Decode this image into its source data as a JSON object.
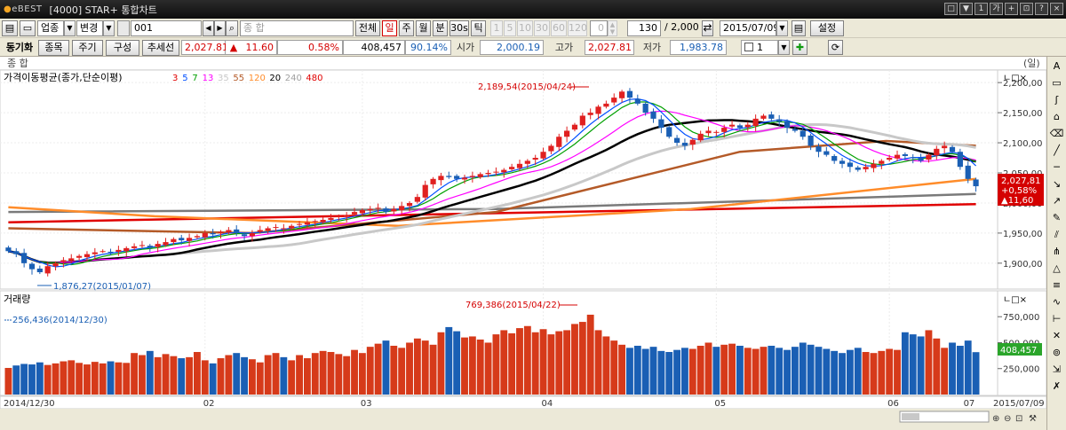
{
  "window": {
    "logo": "eBEST",
    "title": "[4000] STAR+ 통합차트",
    "controls": [
      "□",
      "▼",
      "1",
      "가",
      "+",
      "⊡",
      "?",
      "×"
    ]
  },
  "toolbar": {
    "market_type": "업종",
    "change_label": "변경",
    "code": "001",
    "search_placeholder": "종          합",
    "period_buttons": [
      {
        "label": "전체",
        "active": false
      },
      {
        "label": "일",
        "active": true
      },
      {
        "label": "주",
        "active": false
      },
      {
        "label": "월",
        "active": false
      },
      {
        "label": "분",
        "active": false
      },
      {
        "label": "30s",
        "active": false
      },
      {
        "label": "틱",
        "active": false
      }
    ],
    "interval_buttons": [
      "1",
      "5",
      "10",
      "30",
      "60",
      "120"
    ],
    "interval_value": "0",
    "count_value": "130",
    "total_count": "/ 2,000",
    "date_value": "2015/07/09",
    "settings_label": "설정"
  },
  "quote": {
    "sync_label": "동기화",
    "item_btn": "종목",
    "cycle_btn": "주기",
    "compose_btn": "구성",
    "trend_btn": "추세선",
    "price": "2,027.81",
    "change_arrow": "▲",
    "change": "11.60",
    "change_pct": "0.58%",
    "volume": "408,457",
    "volume_ratio": "90.14%",
    "open_label": "시가",
    "open": "2,000.19",
    "high_label": "고가",
    "high": "2,027.81",
    "low_label": "저가",
    "low": "1,983.78",
    "layout_value": "1"
  },
  "tabstrip": {
    "name": "종          합",
    "unit": "(일)"
  },
  "chart_data": [
    {
      "type": "candlestick",
      "title": "가격이동평균(종가,단순이평)",
      "legend": [
        {
          "name": "3",
          "color": "#e00000"
        },
        {
          "name": "5",
          "color": "#0050ff"
        },
        {
          "name": "7",
          "color": "#00a000"
        },
        {
          "name": "13",
          "color": "#ff00ff"
        },
        {
          "name": "35",
          "color": "#c8c8c8"
        },
        {
          "name": "55",
          "color": "#b45a28"
        },
        {
          "name": "120",
          "color": "#ff8c2a"
        },
        {
          "name": "20",
          "color": "#000000"
        },
        {
          "name": "240",
          "color": "#a0a0a0"
        },
        {
          "name": "480",
          "color": "#e00000"
        }
      ],
      "y_ticks": [
        "2,200,00",
        "2,150,00",
        "2,100,00",
        "2,050,00",
        "2,000,00",
        "1,950,00",
        "1,900,00"
      ],
      "ylim": [
        1860,
        2212
      ],
      "annotations": [
        "2,189,54(2015/04/24)",
        "1,876,27(2015/01/07)"
      ],
      "last_price_tag": [
        "2,027,81",
        "+0,58%",
        "▲11,60"
      ],
      "close_series": [
        1920,
        1915,
        1900,
        1890,
        1885,
        1895,
        1900,
        1905,
        1908,
        1912,
        1915,
        1918,
        1920,
        1918,
        1922,
        1925,
        1928,
        1930,
        1926,
        1932,
        1935,
        1940,
        1938,
        1942,
        1945,
        1950,
        1948,
        1952,
        1955,
        1950,
        1945,
        1950,
        1955,
        1958,
        1960,
        1958,
        1962,
        1965,
        1968,
        1970,
        1972,
        1975,
        1978,
        1980,
        1985,
        1988,
        1990,
        1992,
        1985,
        1990,
        1995,
        2000,
        2010,
        2030,
        2040,
        2045,
        2043,
        2040,
        2042,
        2045,
        2048,
        2050,
        2052,
        2055,
        2060,
        2065,
        2070,
        2075,
        2085,
        2095,
        2110,
        2120,
        2130,
        2145,
        2150,
        2160,
        2165,
        2175,
        2185,
        2175,
        2165,
        2150,
        2140,
        2125,
        2110,
        2100,
        2095,
        2105,
        2115,
        2120,
        2118,
        2125,
        2130,
        2125,
        2130,
        2140,
        2145,
        2140,
        2135,
        2125,
        2120,
        2110,
        2095,
        2085,
        2080,
        2070,
        2065,
        2060,
        2055,
        2060,
        2065,
        2070,
        2075,
        2080,
        2078,
        2075,
        2070,
        2080,
        2090,
        2095,
        2085,
        2060,
        2040,
        2027.81
      ],
      "moving_averages": [
        {
          "name": "20",
          "color": "#000000"
        },
        {
          "name": "35",
          "color": "#c8c8c8"
        },
        {
          "name": "55",
          "color": "#b45a28"
        },
        {
          "name": "120",
          "color": "#ff8c2a"
        },
        {
          "name": "240",
          "color": "#7a7a7a"
        },
        {
          "name": "480",
          "color": "#e00000"
        }
      ]
    },
    {
      "type": "bar",
      "title": "거래량",
      "y_ticks": [
        "750,000",
        "500,000",
        "250,000"
      ],
      "ylim": [
        0,
        880000
      ],
      "last_value_tag": "408,457",
      "annotations": [
        "769,386(2015/04/22)",
        "256,436(2014/12/30)"
      ],
      "x_labels": [
        "2014/12/30",
        "02",
        "03",
        "04",
        "05",
        "06",
        "07",
        "2015/07/09"
      ],
      "values": [
        256436,
        280000,
        295000,
        290000,
        310000,
        285000,
        300000,
        320000,
        330000,
        305000,
        290000,
        315000,
        300000,
        320000,
        310000,
        305000,
        400000,
        380000,
        420000,
        360000,
        390000,
        370000,
        350000,
        360000,
        410000,
        330000,
        300000,
        350000,
        380000,
        400000,
        360000,
        340000,
        310000,
        380000,
        400000,
        360000,
        330000,
        380000,
        350000,
        400000,
        420000,
        410000,
        390000,
        370000,
        430000,
        400000,
        460000,
        490000,
        520000,
        470000,
        450000,
        500000,
        540000,
        520000,
        480000,
        600000,
        650000,
        610000,
        550000,
        560000,
        530000,
        500000,
        580000,
        620000,
        590000,
        640000,
        660000,
        600000,
        630000,
        580000,
        610000,
        620000,
        680000,
        700000,
        769386,
        620000,
        560000,
        520000,
        480000,
        450000,
        470000,
        440000,
        460000,
        420000,
        410000,
        430000,
        450000,
        440000,
        470000,
        500000,
        460000,
        480000,
        490000,
        470000,
        450000,
        440000,
        460000,
        470000,
        450000,
        430000,
        460000,
        500000,
        480000,
        460000,
        440000,
        420000,
        400000,
        430000,
        450000,
        410000,
        400000,
        420000,
        440000,
        430000,
        600000,
        580000,
        560000,
        620000,
        540000,
        450000,
        500000,
        470000,
        520000,
        408457
      ]
    }
  ],
  "bottom": {
    "zoom": "25%"
  }
}
